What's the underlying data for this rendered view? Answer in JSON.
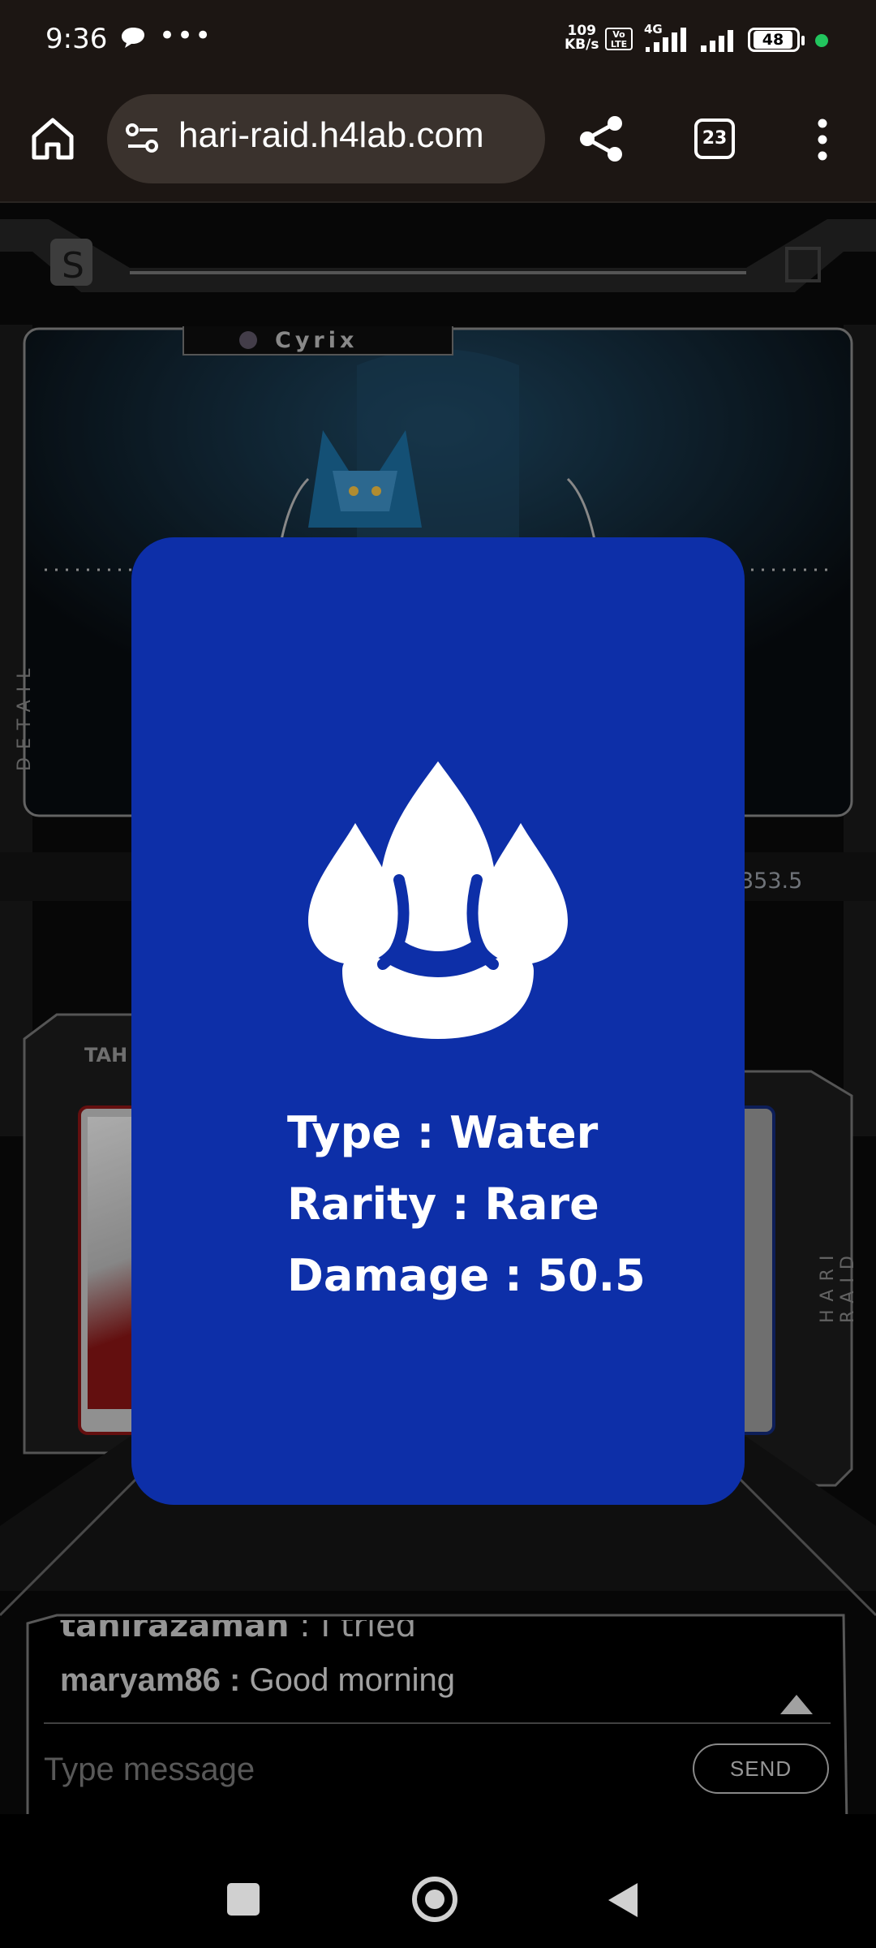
{
  "status_bar": {
    "time": "9:36",
    "speed_value": "109",
    "speed_unit": "KB/s",
    "volte": "Vo LTE",
    "network": "4G",
    "battery": "48",
    "icons": [
      "chat-bubble-icon",
      "more-dots-icon",
      "signal-icon",
      "battery-icon"
    ]
  },
  "browser": {
    "url": "hari-raid.h4lab.com",
    "tab_count": "23",
    "icons": [
      "home-icon",
      "site-settings-icon",
      "share-icon",
      "tabs-icon",
      "overflow-menu-icon"
    ]
  },
  "game": {
    "character_name": "Cyrix",
    "side_label_left": "DETAIL",
    "side_label_right": "HARI RAID",
    "stat_value": "353.5",
    "opponent_tag": "TAH"
  },
  "card_modal": {
    "icon": "water-drops-icon",
    "accent_color": "#0d2fa8",
    "type_label": "Type",
    "type_value": "Water",
    "rarity_label": "Rarity",
    "rarity_value": "Rare",
    "damage_label": "Damage",
    "damage_value": "50.5",
    "separator": ":"
  },
  "chat": {
    "previous_message": {
      "user": "tahirazaman",
      "text": "I tried"
    },
    "last_message": {
      "user": "maryam86",
      "text": "Good morning"
    },
    "input_placeholder": "Type message",
    "send_label": "SEND"
  },
  "nav_bar": {
    "icons": [
      "recent-apps-icon",
      "home-circle-icon",
      "back-triangle-icon"
    ]
  }
}
